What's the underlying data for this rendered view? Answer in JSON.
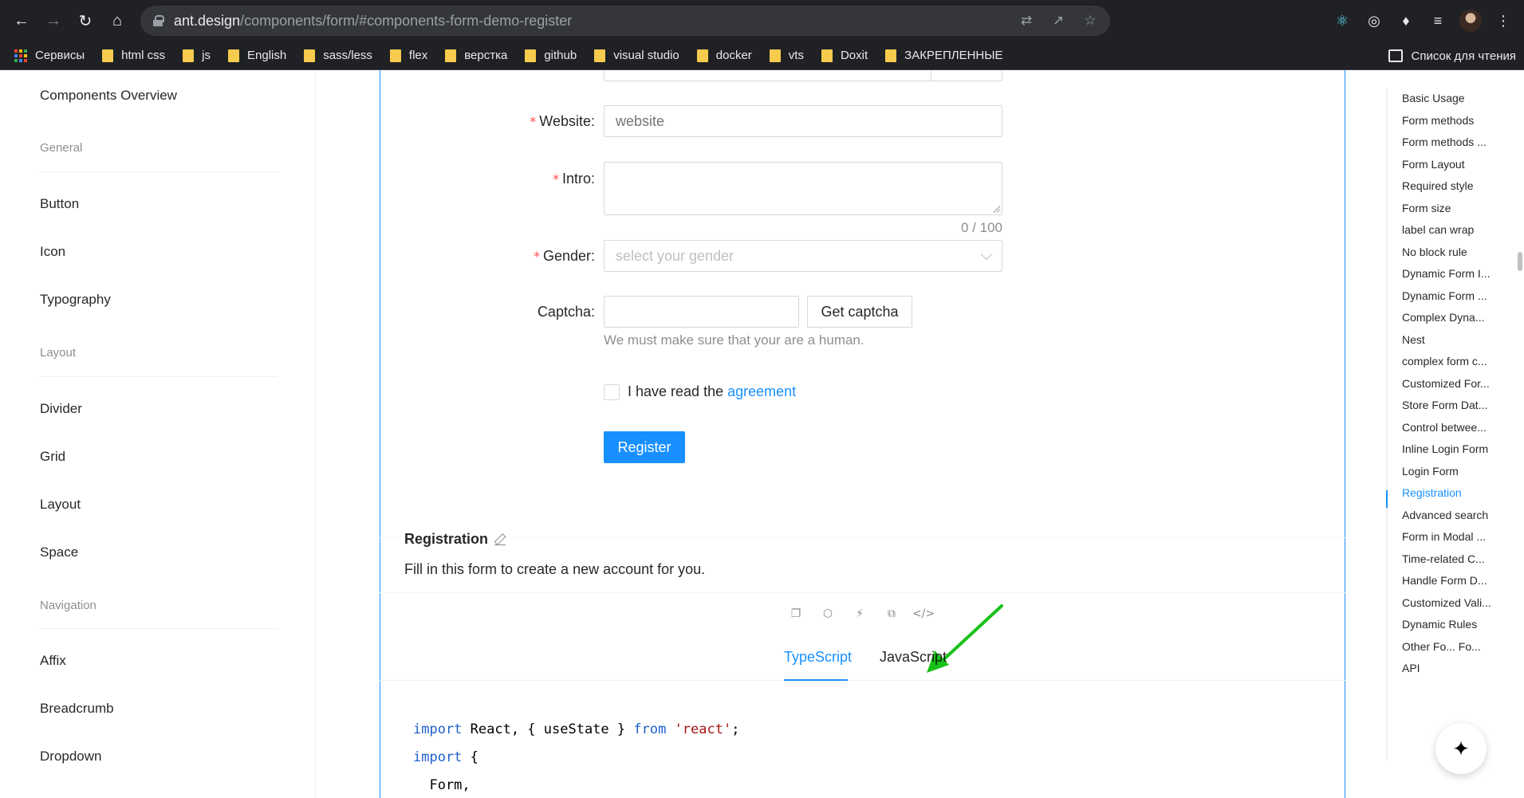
{
  "browser": {
    "url_host": "ant.design",
    "url_path": "/components/form/#components-form-demo-register",
    "bookmarks": [
      "Сервисы",
      "html css",
      "js",
      "English",
      "sass/less",
      "flex",
      "верстка",
      "github",
      "visual studio",
      "docker",
      "vts",
      "Doxit",
      "ЗАКРЕПЛЕННЫЕ"
    ],
    "reading_list": "Список для чтения"
  },
  "sidebar": {
    "overview": "Components Overview",
    "groups": [
      {
        "title": "General",
        "items": [
          "Button",
          "Icon",
          "Typography"
        ]
      },
      {
        "title": "Layout",
        "items": [
          "Divider",
          "Grid",
          "Layout",
          "Space"
        ]
      },
      {
        "title": "Navigation",
        "items": [
          "Affix",
          "Breadcrumb",
          "Dropdown"
        ]
      }
    ]
  },
  "form": {
    "website": {
      "label": "Website",
      "placeholder": "website"
    },
    "intro": {
      "label": "Intro",
      "counter": "0 / 100"
    },
    "gender": {
      "label": "Gender",
      "placeholder": "select your gender"
    },
    "captcha": {
      "label": "Captcha",
      "button": "Get captcha",
      "extra": "We must make sure that your are a human."
    },
    "agreement": {
      "prefix": "I have read the",
      "link": "agreement"
    },
    "register_button": "Register"
  },
  "demo": {
    "title": "Registration",
    "description": "Fill in this form to create a new account for you.",
    "actions": [
      "codesandbox-icon",
      "codepen-icon",
      "stackblitz-icon",
      "copy-icon",
      "expand-code-icon"
    ],
    "tabs": [
      "TypeScript",
      "JavaScript"
    ],
    "active_tab": "TypeScript",
    "code": {
      "line1": {
        "kw1": "import",
        "mid": " React, { useState } ",
        "kw2": "from",
        "sp": " ",
        "str": "'react'",
        "end": ";"
      },
      "line2": {
        "kw1": "import",
        "end": " {"
      },
      "line3": "  Form,"
    }
  },
  "toc": {
    "items": [
      "Basic Usage",
      "Form methods",
      "Form methods ...",
      "Form Layout",
      "Required style",
      "Form size",
      "label can wrap",
      "No block rule",
      "Dynamic Form I...",
      "Dynamic Form ...",
      "Complex Dyna...",
      "Nest",
      "complex form c...",
      "Customized For...",
      "Store Form Dat...",
      "Control betwee...",
      "Inline Login Form",
      "Login Form",
      "Registration",
      "Advanced search",
      "Form in Modal ...",
      "Time-related C...",
      "Handle Form D...",
      "Customized Vali...",
      "Dynamic Rules",
      "Other Fo... Fo...",
      "API"
    ],
    "active": "Registration"
  },
  "colors": {
    "primary": "#1890ff",
    "required": "#ff4d4f",
    "annotation_arrow": "#19c119"
  }
}
